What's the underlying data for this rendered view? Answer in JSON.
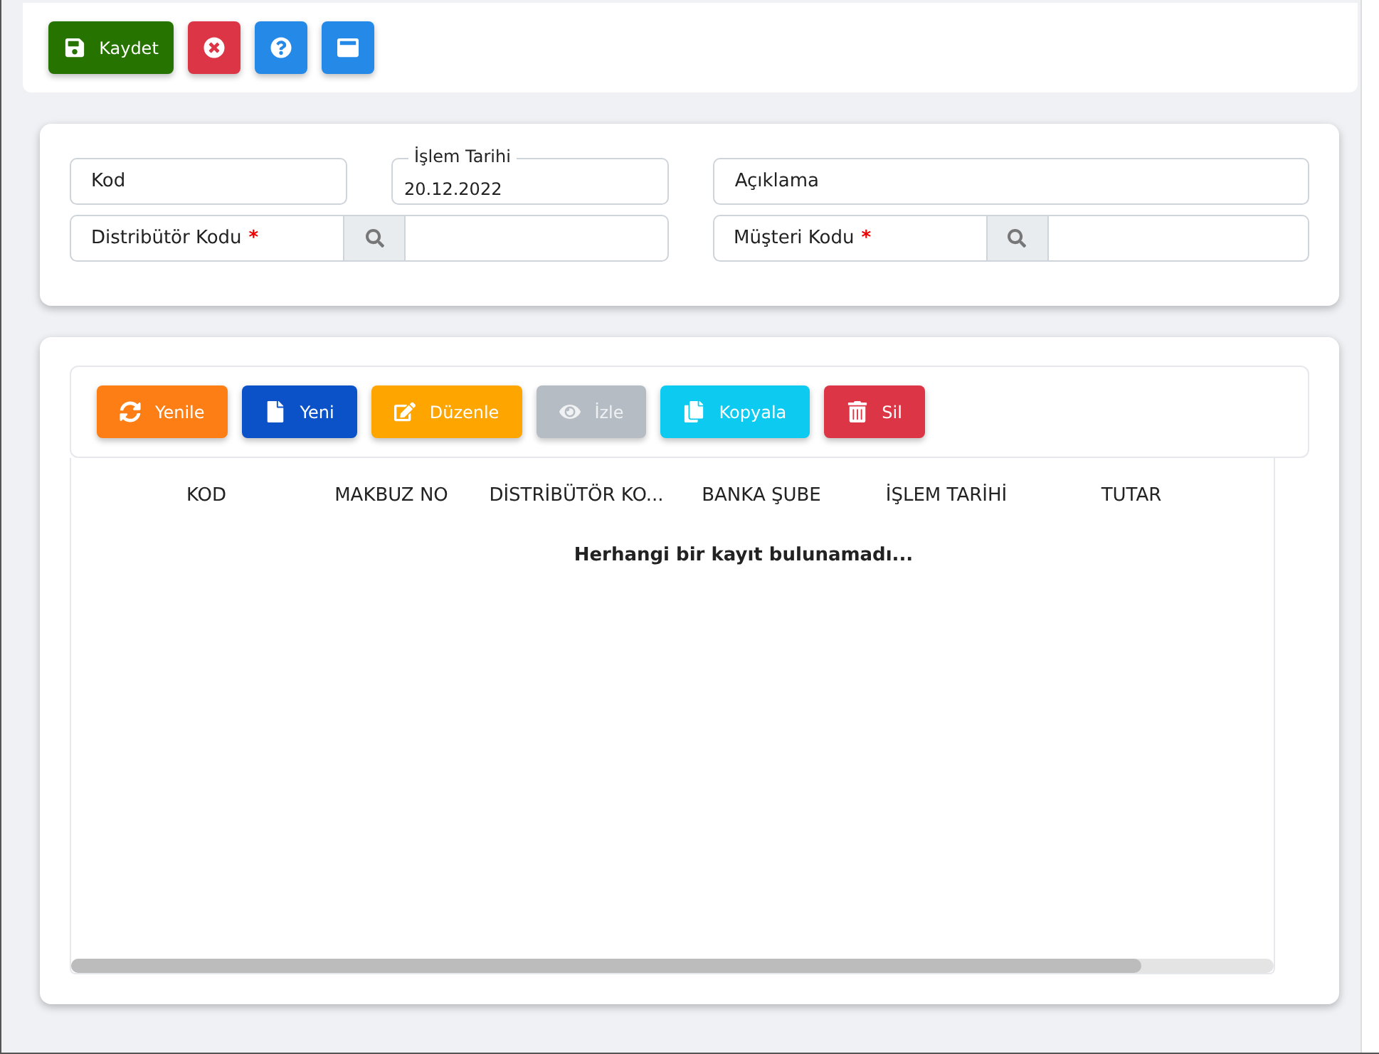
{
  "top_toolbar": [
    {
      "kind": "save",
      "label": "Kaydet",
      "color": "#267300"
    },
    {
      "kind": "cancel",
      "color": "#dc3545"
    },
    {
      "kind": "help",
      "color": "#2589e8"
    },
    {
      "kind": "window",
      "color": "#2589e8"
    }
  ],
  "form": {
    "row_1": [
      {
        "kind": "plain",
        "placeholder": "Kod"
      },
      {
        "kind": "floating",
        "label": "İşlem Tarihi",
        "value": "20.12.2022"
      },
      {
        "kind": "plain",
        "placeholder": "Açıklama"
      }
    ],
    "row_2": [
      {
        "label": "Distribütör Kodu",
        "required_mark": "*"
      },
      {
        "label": "Müşteri Kodu",
        "required_mark": "*"
      }
    ]
  },
  "grid_toolbar": [
    {
      "kind": "refresh",
      "label": "Yenile",
      "color": "#fd7e14",
      "disabled": false
    },
    {
      "kind": "new",
      "label": "Yeni",
      "color": "#0b52c9",
      "disabled": false
    },
    {
      "kind": "edit",
      "label": "Düzenle",
      "color": "#ffa500",
      "disabled": false
    },
    {
      "kind": "view",
      "label": "İzle",
      "color": "#adb5bd",
      "disabled": true
    },
    {
      "kind": "copy",
      "label": "Kopyala",
      "color": "#0dcaf0",
      "disabled": false
    },
    {
      "kind": "delete",
      "label": "Sil",
      "color": "#dc3545",
      "disabled": false
    }
  ],
  "table": {
    "columns": [
      "KOD",
      "MAKBUZ NO",
      "DİSTRİBÜTÖR KO...",
      "BANKA ŞUBE",
      "İŞLEM TARİHİ",
      "TUTAR"
    ],
    "empty_message": "Herhangi bir kayıt bulunamadı..."
  }
}
